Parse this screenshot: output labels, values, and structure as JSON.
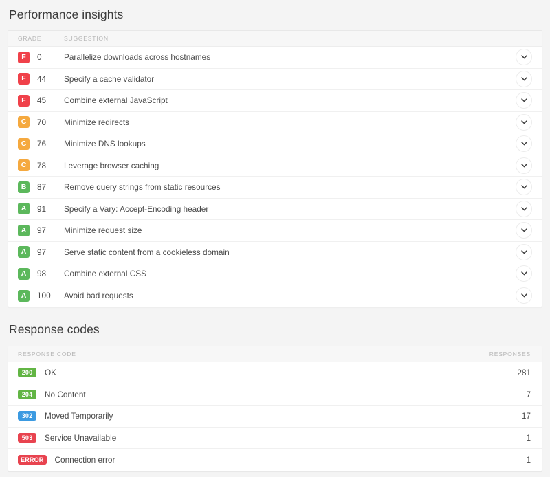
{
  "performance": {
    "title": "Performance insights",
    "columns": {
      "grade": "GRADE",
      "suggestion": "SUGGESTION"
    },
    "expand_icon": "chevron-down-icon",
    "grade_colors": {
      "A": "#5cb85c",
      "B": "#5cb85c",
      "C": "#f5a93f",
      "F": "#f0414a"
    },
    "rows": [
      {
        "grade": "F",
        "score": "0",
        "suggestion": "Parallelize downloads across hostnames"
      },
      {
        "grade": "F",
        "score": "44",
        "suggestion": "Specify a cache validator"
      },
      {
        "grade": "F",
        "score": "45",
        "suggestion": "Combine external JavaScript"
      },
      {
        "grade": "C",
        "score": "70",
        "suggestion": "Minimize redirects"
      },
      {
        "grade": "C",
        "score": "76",
        "suggestion": "Minimize DNS lookups"
      },
      {
        "grade": "C",
        "score": "78",
        "suggestion": "Leverage browser caching"
      },
      {
        "grade": "B",
        "score": "87",
        "suggestion": "Remove query strings from static resources"
      },
      {
        "grade": "A",
        "score": "91",
        "suggestion": "Specify a Vary: Accept-Encoding header"
      },
      {
        "grade": "A",
        "score": "97",
        "suggestion": "Minimize request size"
      },
      {
        "grade": "A",
        "score": "97",
        "suggestion": "Serve static content from a cookieless domain"
      },
      {
        "grade": "A",
        "score": "98",
        "suggestion": "Combine external CSS"
      },
      {
        "grade": "A",
        "score": "100",
        "suggestion": "Avoid bad requests"
      }
    ]
  },
  "response_codes": {
    "title": "Response codes",
    "columns": {
      "code": "RESPONSE CODE",
      "responses": "RESPONSES"
    },
    "rows": [
      {
        "code": "200",
        "label": "OK",
        "count": "281",
        "color": "#62b544"
      },
      {
        "code": "204",
        "label": "No Content",
        "count": "7",
        "color": "#62b544"
      },
      {
        "code": "302",
        "label": "Moved Temporarily",
        "count": "17",
        "color": "#3b9ae1"
      },
      {
        "code": "503",
        "label": "Service Unavailable",
        "count": "1",
        "color": "#e8434f"
      },
      {
        "code": "ERROR",
        "label": "Connection error",
        "count": "1",
        "color": "#e8434f"
      }
    ]
  }
}
